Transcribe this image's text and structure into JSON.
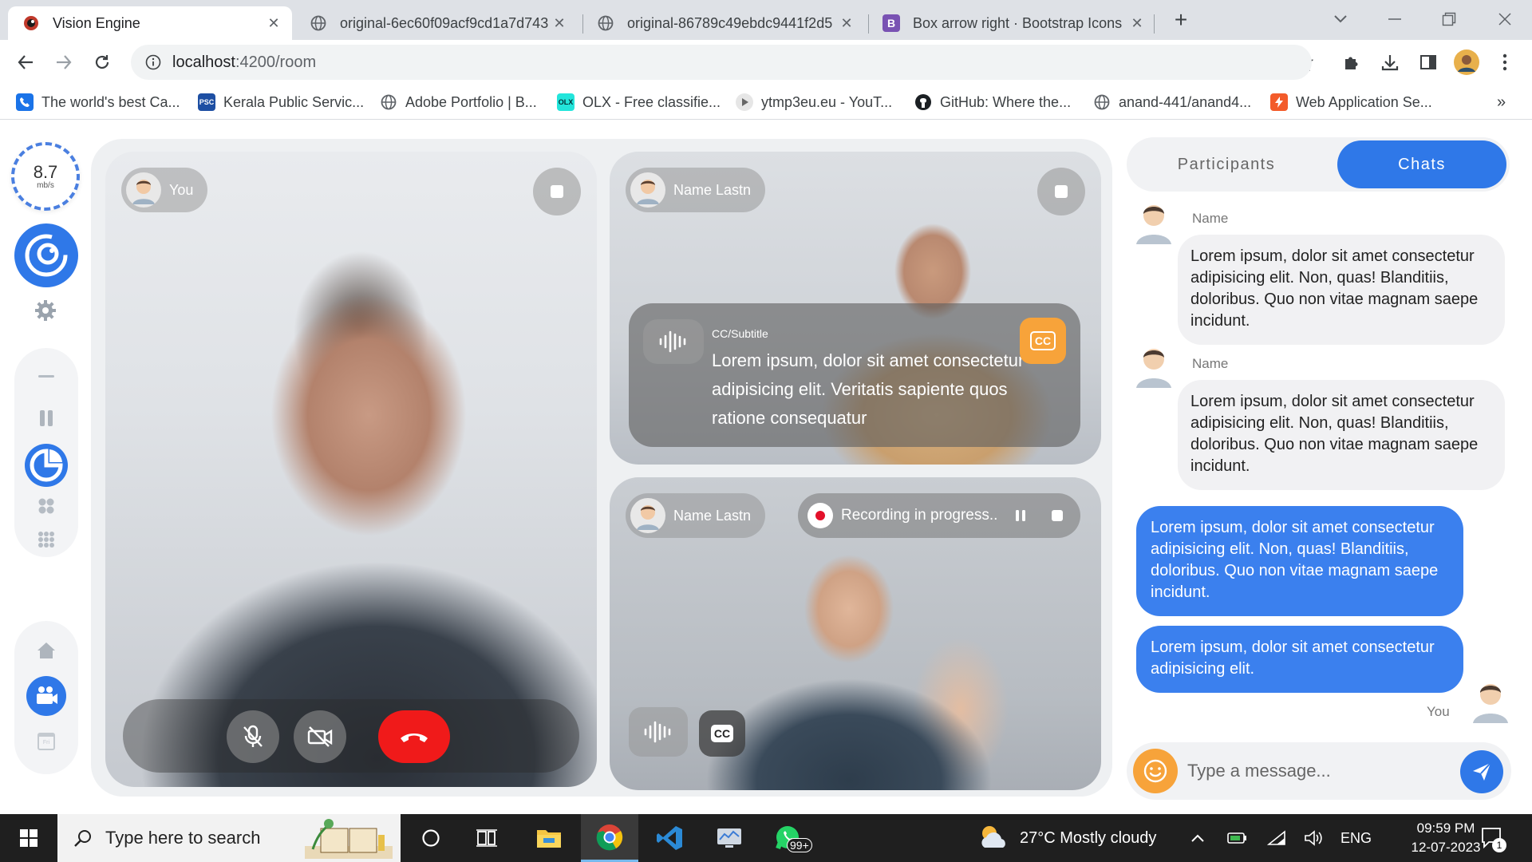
{
  "browser": {
    "tabs": [
      {
        "title": "Vision Engine",
        "active": true
      },
      {
        "title": "original-6ec60f09acf9cd1a7d743",
        "active": false
      },
      {
        "title": "original-86789c49ebdc9441f2d5",
        "active": false
      },
      {
        "title": "Box arrow right · Bootstrap Icons",
        "active": false
      }
    ],
    "url_host": "localhost",
    "url_path": ":4200/room",
    "bookmarks": [
      "The world's best Ca...",
      "Kerala Public Servic...",
      "Adobe Portfolio | B...",
      "OLX - Free classifie...",
      "ytmp3eu.eu - YouT...",
      "GitHub: Where the...",
      "anand-441/anand4...",
      "Web Application Se..."
    ],
    "bookmark_badges": {
      "psc": "PSC",
      "olx": "OLX",
      "bootstrap": "B"
    },
    "more_bookmarks": "»"
  },
  "app": {
    "speed": {
      "value": "8.7",
      "unit": "mb/s"
    },
    "tiles": {
      "you": {
        "name": "You"
      },
      "p1": {
        "name": "Name Lastn",
        "cc_label": "CC/Subtitle",
        "cc_text": "Lorem ipsum, dolor sit amet consectetur adipisicing elit. Veritatis sapiente quos ratione consequatur",
        "cc_badge": "CC"
      },
      "p2": {
        "name": "Name Lastn",
        "recording": "Recording in progress..",
        "cc_badge": "CC"
      }
    },
    "rail": {
      "calendar_day": "Fri"
    },
    "panel": {
      "tabs": {
        "participants": "Participants",
        "chats": "Chats"
      },
      "messages_in": [
        {
          "name": "Name",
          "text": "Lorem ipsum, dolor sit amet consectetur adipisicing elit. Non, quas! Blanditiis, doloribus. Quo non vitae magnam saepe incidunt."
        },
        {
          "name": "Name",
          "text": "Lorem ipsum, dolor sit amet consectetur adipisicing elit. Non, quas! Blanditiis, doloribus. Quo non vitae magnam saepe incidunt."
        }
      ],
      "messages_out": [
        {
          "text": "Lorem ipsum, dolor sit amet consectetur adipisicing elit. Non, quas! Blanditiis, doloribus. Quo non vitae magnam saepe incidunt."
        },
        {
          "text": "Lorem ipsum, dolor sit amet consectetur adipisicing elit."
        }
      ],
      "you_label": "You",
      "composer_placeholder": "Type a message..."
    },
    "colors": {
      "accent": "#2f78e8",
      "end_call": "#f01a1a",
      "cc_badge": "#f7a33a",
      "recording": "#e3102a"
    }
  },
  "taskbar": {
    "search_placeholder": "Type here to search",
    "whatsapp_badge": "99+",
    "weather": "27°C  Mostly cloudy",
    "lang": "ENG",
    "time": "09:59 PM",
    "date": "12-07-2023",
    "notification_count": "1"
  }
}
